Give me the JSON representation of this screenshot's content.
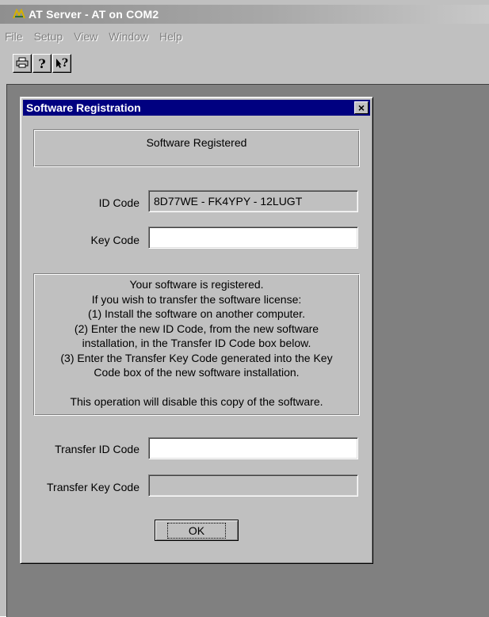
{
  "window": {
    "title": "AT Server - AT on COM2"
  },
  "menu": [
    {
      "label": "File"
    },
    {
      "label": "Setup"
    },
    {
      "label": "View"
    },
    {
      "label": "Window"
    },
    {
      "label": "Help"
    }
  ],
  "toolbar": {
    "buttons": [
      {
        "icon": "printer-icon"
      },
      {
        "icon": "help-icon"
      },
      {
        "icon": "context-help-icon",
        "label": "?"
      }
    ],
    "help_glyph": "?",
    "context_help_glyph": "?"
  },
  "dialog": {
    "title": "Software Registration",
    "close_glyph": "×",
    "status": "Software Registered",
    "id_code_label": "ID Code",
    "id_code_value": "8D77WE - FK4YPY - 12LUGT",
    "key_code_label": "Key Code",
    "key_code_value": "",
    "info_lines": [
      "Your software is registered.",
      "If you wish to transfer the software license:",
      "(1)  Install the software on another computer.",
      "(2)  Enter the new ID Code, from the new software",
      "installation, in the Transfer ID Code box below.",
      "(3)  Enter the Transfer Key Code generated into the Key",
      "Code box of the new software installation.",
      "",
      "This operation will disable this copy of the software."
    ],
    "transfer_id_label": "Transfer ID Code",
    "transfer_id_value": "",
    "transfer_key_label": "Transfer Key Code",
    "transfer_key_value": "",
    "ok_label": "OK"
  },
  "colors": {
    "dialog_titlebar": "#000080",
    "window_face": "#c0c0c0",
    "mdi_background": "#808080"
  }
}
